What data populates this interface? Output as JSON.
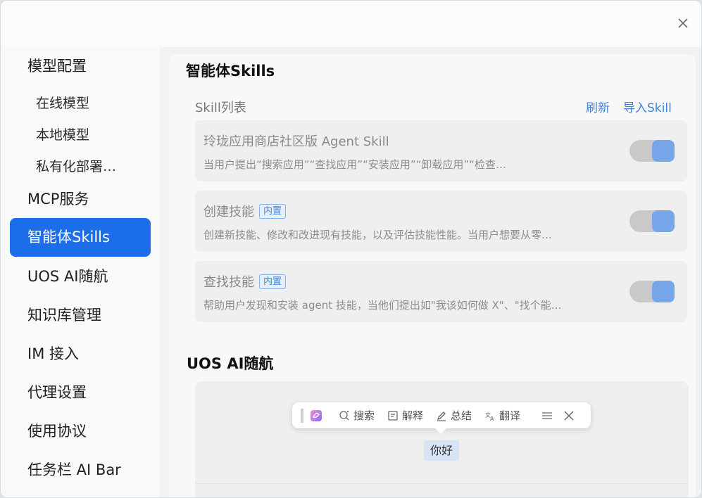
{
  "window": {
    "close_icon": "close-icon"
  },
  "sidebar": {
    "model_config": "模型配置",
    "online_model": "在线模型",
    "local_model": "本地模型",
    "private_deploy": "私有化部署…",
    "mcp": "MCP服务",
    "skills": "智能体Skills",
    "uos_ai_nav": "UOS AI随航",
    "kb_manage": "知识库管理",
    "im": "IM 接入",
    "proxy": "代理设置",
    "agreement": "使用协议",
    "taskbar": "任务栏 AI Bar"
  },
  "skills_section": {
    "title": "智能体Skills",
    "list_label": "Skill列表",
    "refresh": "刷新",
    "import": "导入Skill",
    "items": [
      {
        "name": "玲珑应用商店社区版 Agent Skill",
        "badge": "",
        "desc": "当用户提出“搜索应用”“查找应用”“安装应用”“卸载应用”“检查…",
        "enabled": true
      },
      {
        "name": "创建技能",
        "badge": "内置",
        "desc": "创建新技能、修改和改进现有技能，以及评估技能性能。当用户想要从零…",
        "enabled": true
      },
      {
        "name": "查找技能",
        "badge": "内置",
        "desc": "帮助用户发现和安装 agent 技能，当他们提出如\"我该如何做 X\"、\"找个能…",
        "enabled": true
      }
    ]
  },
  "nav_section": {
    "title": "UOS AI随航",
    "toolbar": {
      "search": "搜索",
      "explain": "解释",
      "summary": "总结",
      "translate": "翻译"
    },
    "greeting": "你好"
  },
  "colors": {
    "accent": "#1c6ee8",
    "link": "#3d84d8",
    "toggle_on": "#76a6e9"
  }
}
